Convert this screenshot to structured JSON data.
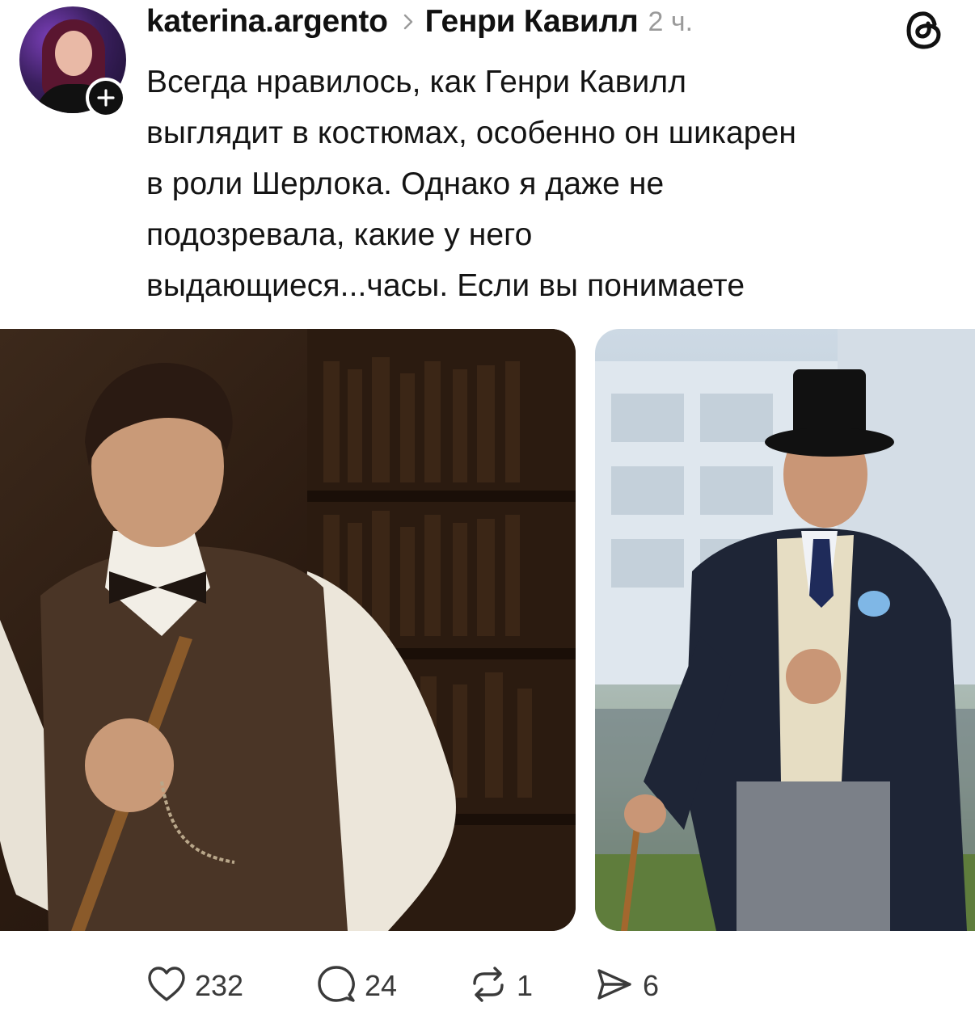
{
  "post": {
    "username": "katerina.argento",
    "topic": "Генри Кавилл",
    "time": "2 ч.",
    "text_lines": [
      "Всегда нравилось, как Генри Кавилл",
      "выглядит в костюмах, особенно он шикарен",
      "в роли Шерлока. Однако я даже не",
      "подозревала, какие у него",
      "выдающиеся...часы. Если вы понимаете"
    ]
  },
  "actions": {
    "likes": "232",
    "replies": "24",
    "reposts": "1",
    "shares": "6"
  },
  "icons": {
    "avatar": "user-avatar",
    "follow": "plus-icon",
    "separator": "chevron-right-icon",
    "app": "threads-logo-icon",
    "like": "heart-icon",
    "reply": "comment-icon",
    "repost": "repost-icon",
    "share": "send-icon"
  },
  "colors": {
    "text": "#111111",
    "muted": "#9a9a9a",
    "icon": "#3a3a3a",
    "background": "#ffffff"
  }
}
